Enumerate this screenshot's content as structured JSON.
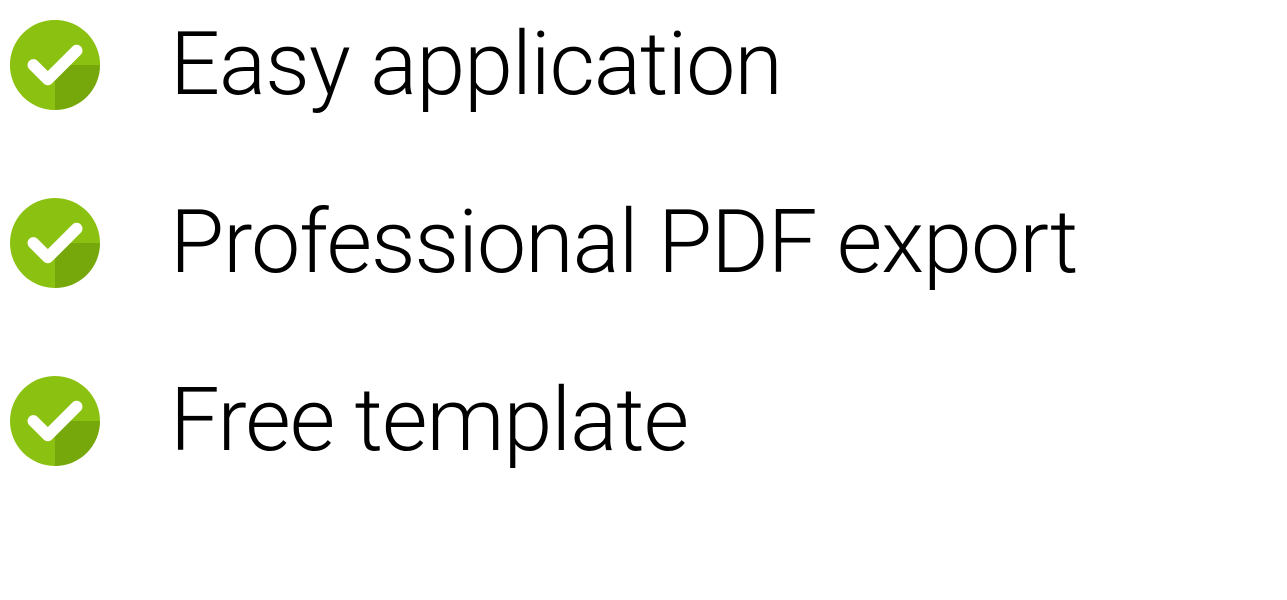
{
  "features": {
    "items": [
      {
        "label": "Easy application"
      },
      {
        "label": "Professional PDF export"
      },
      {
        "label": "Free template"
      }
    ]
  },
  "colors": {
    "checkmark_primary": "#8bc110",
    "checkmark_shadow": "#6b9b0a",
    "checkmark_white": "#ffffff"
  }
}
